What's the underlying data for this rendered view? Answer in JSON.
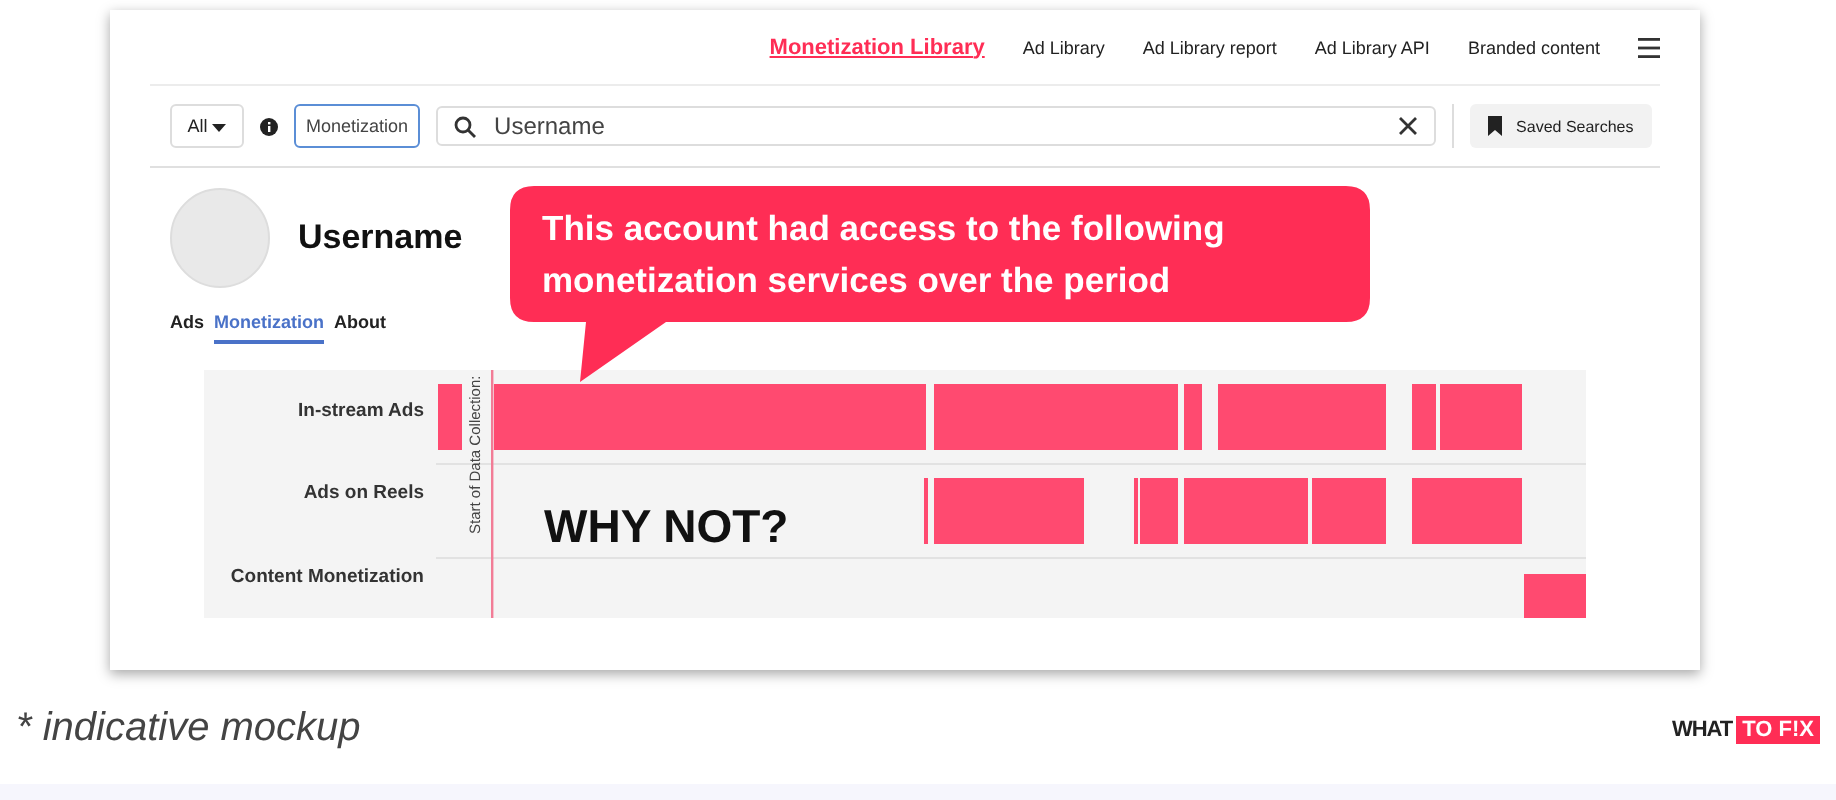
{
  "nav": {
    "links": [
      {
        "label": "Monetization Library",
        "selected": true
      },
      {
        "label": "Ad Library",
        "selected": false
      },
      {
        "label": "Ad Library report",
        "selected": false
      },
      {
        "label": "Ad Library API",
        "selected": false
      },
      {
        "label": "Branded content",
        "selected": false
      }
    ]
  },
  "search": {
    "filter": "All",
    "type_field": "Monetization",
    "query": "Username",
    "saved_button": "Saved Searches"
  },
  "profile": {
    "name": "Username"
  },
  "tabs": [
    {
      "label": "Ads",
      "selected": false
    },
    {
      "label": "Monetization",
      "selected": true
    },
    {
      "label": "About",
      "selected": false
    }
  ],
  "timeline": {
    "rows": [
      "In-stream Ads",
      "Ads on Reels",
      "Content Monetization"
    ],
    "marker": "Start of Data Collection:",
    "overlay": "WHY NOT?"
  },
  "callout": "This account had access to the following monetization services over the period",
  "footnote": "* indicative mockup",
  "logo": {
    "left": "WHAT",
    "right": "TO F!X"
  }
}
